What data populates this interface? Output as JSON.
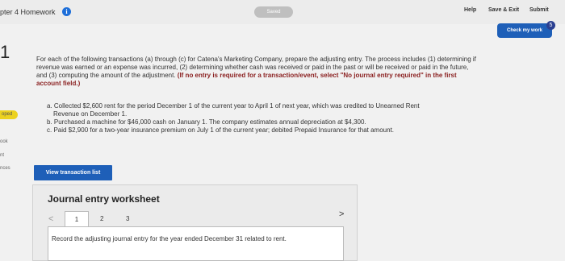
{
  "header": {
    "title": "pter 4 Homework",
    "info_icon": "i",
    "saved": "Saved",
    "help": "Help",
    "save_exit": "Save & Exit",
    "submit": "Submit",
    "check_work": "Check my work",
    "check_badge": "5"
  },
  "question_number": "1",
  "sidebar": {
    "badge": "oped",
    "links": [
      "ook",
      "nt",
      "nces"
    ]
  },
  "instructions": {
    "text": "For each of the following transactions (a) through (c) for Catena's Marketing Company, prepare the adjusting entry. The process includes (1) determining if revenue was earned or an expense was incurred, (2) determining whether cash was received or paid in the past or will be received or paid in the future, and (3) computing the amount of the adjustment.",
    "emphasis": "(If no entry is required for a transaction/event, select \"No journal entry required\" in the first account field.)"
  },
  "transactions": [
    {
      "line1": "a. Collected $2,600 rent for the period December 1 of the current year to April 1 of next year, which was credited to Unearned Rent",
      "line2": "Revenue on December 1."
    },
    {
      "line1": "b. Purchased a machine for $46,000 cash on January 1. The company estimates annual depreciation at $4,300."
    },
    {
      "line1": "c. Paid $2,900 for a two-year insurance premium on July 1 of the current year; debited Prepaid Insurance for that amount."
    }
  ],
  "view_button": "View transaction list",
  "worksheet": {
    "title": "Journal entry worksheet",
    "prev": "<",
    "next": ">",
    "tabs": [
      "1",
      "2",
      "3"
    ],
    "panel_text": "Record the adjusting journal entry for the year ended December 31 related to rent."
  }
}
